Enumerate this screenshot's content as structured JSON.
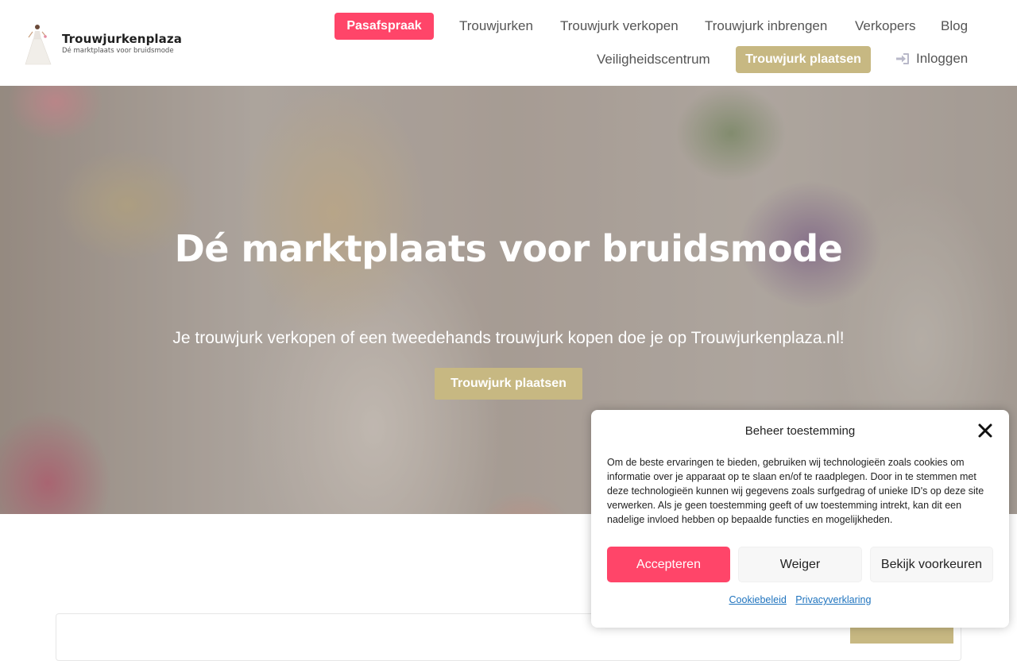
{
  "header": {
    "logo_name": "Trouwjurkenplaza",
    "logo_tagline": "Dé marktplaats voor bruidsmode",
    "nav": {
      "pasafspraak": "Pasafspraak",
      "trouwjurken": "Trouwjurken",
      "verkopen": "Trouwjurk verkopen",
      "inbrengen": "Trouwjurk inbrengen",
      "verkopers": "Verkopers",
      "blog": "Blog",
      "veiligheid": "Veiligheidscentrum",
      "plaatsen": "Trouwjurk plaatsen",
      "inloggen": "Inloggen"
    }
  },
  "hero": {
    "title": "Dé marktplaats voor bruidsmode",
    "subtitle": "Je trouwjurk verkopen of een tweedehands trouwjurk kopen doe je op Trouwjurkenplaza.nl!",
    "cta": "Trouwjurk plaatsen"
  },
  "consent": {
    "title": "Beheer toestemming",
    "body": "Om de beste ervaringen te bieden, gebruiken wij technologieën zoals cookies om informatie over je apparaat op te slaan en/of te raadplegen. Door in te stemmen met deze technologieën kunnen wij gegevens zoals surfgedrag of unieke ID's op deze site verwerken. Als je geen toestemming geeft of uw toestemming intrekt, kan dit een nadelige invloed hebben op bepaalde functies en mogelijkheden.",
    "accept": "Accepteren",
    "deny": "Weiger",
    "preferences": "Bekijk voorkeuren",
    "link_cookie": "Cookiebeleid",
    "link_privacy": "Privacyverklaring"
  },
  "colors": {
    "accent_red": "#ff4569",
    "accent_gold": "#c7b882"
  }
}
